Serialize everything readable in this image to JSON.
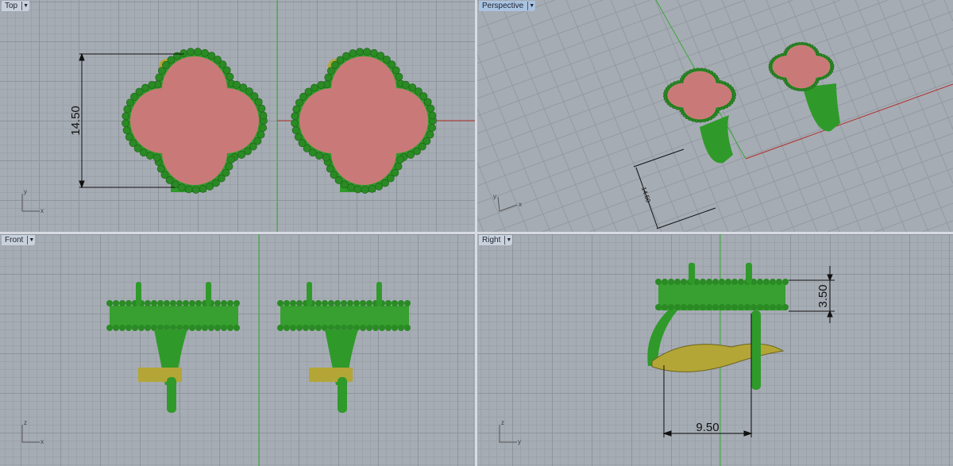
{
  "viewports": [
    {
      "label": "Top",
      "active": false
    },
    {
      "label": "Perspective",
      "active": true
    },
    {
      "label": "Front",
      "active": false
    },
    {
      "label": "Right",
      "active": false
    }
  ],
  "dimensions": {
    "top_height": "14.50",
    "persp_height": "14.50",
    "right_height": "3.50",
    "right_width": "9.50"
  },
  "axes": {
    "x": "x",
    "y": "y",
    "z": "z"
  },
  "colors": {
    "stone": "#c97a78",
    "metal_green": "#2f9a2a",
    "bead": "#2a8a24",
    "gold": "#b3a636",
    "x_axis": "#b0302c",
    "y_axis": "#3aa83a"
  }
}
